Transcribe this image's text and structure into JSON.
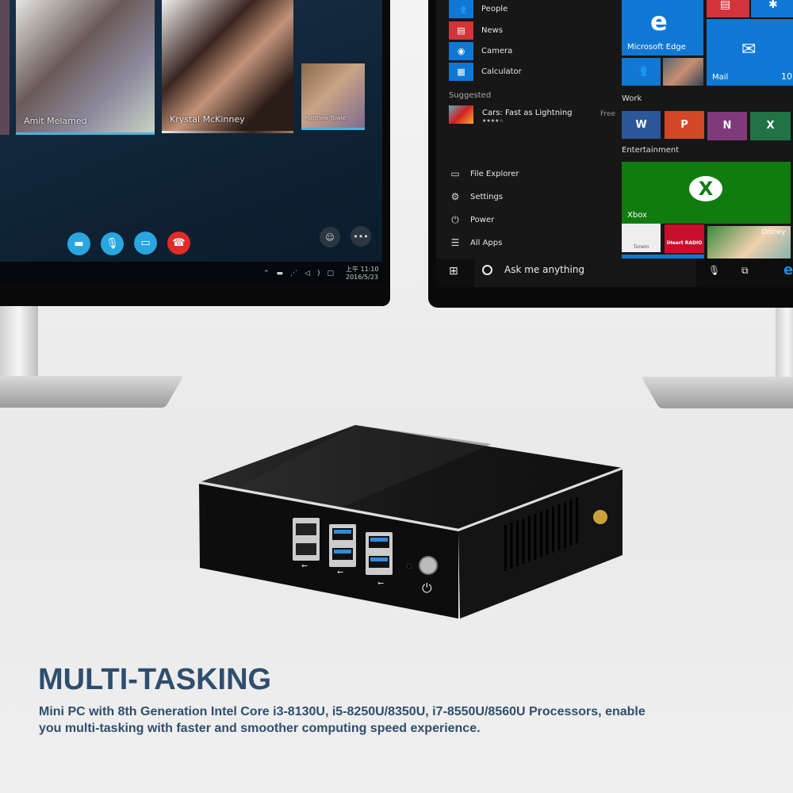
{
  "video_call": {
    "participants": [
      {
        "name": "Amit Melamed"
      },
      {
        "name": "Krystal McKinney"
      },
      {
        "name": "Matthew Towle"
      }
    ],
    "controls": [
      "video-icon",
      "microphone-icon",
      "screen-share-icon",
      "end-call-icon"
    ],
    "extra_controls": [
      "add-participant-icon",
      "more-icon"
    ],
    "more_label": "•••",
    "taskbar": {
      "time": "上午 11:10",
      "date": "2016/5/23"
    },
    "accent": "#29a6e0",
    "end_call_color": "#e12b2b"
  },
  "start_menu": {
    "apps": [
      {
        "label": "People",
        "icon": "people-icon",
        "color": "#0f78d4"
      },
      {
        "label": "News",
        "icon": "news-icon",
        "color": "#d1343a"
      },
      {
        "label": "Camera",
        "icon": "camera-icon",
        "color": "#0f78d4"
      },
      {
        "label": "Calculator",
        "icon": "calculator-icon",
        "color": "#0f78d4"
      }
    ],
    "suggested_heading": "Suggested",
    "suggested": {
      "title": "Cars: Fast as Lightning",
      "price": "Free",
      "rating": "★★★★☆"
    },
    "bottom": [
      {
        "label": "File Explorer",
        "icon": "folder-icon"
      },
      {
        "label": "Settings",
        "icon": "gear-icon"
      },
      {
        "label": "Power",
        "icon": "power-icon"
      },
      {
        "label": "All Apps",
        "icon": "list-icon"
      }
    ],
    "tiles": {
      "edge": "Microsoft Edge",
      "mail": "Mail",
      "mail_count": "10",
      "work_heading": "Work",
      "work_apps": [
        {
          "letter": "W",
          "color": "#2b579a"
        },
        {
          "letter": "P",
          "color": "#d24726"
        },
        {
          "letter": "N",
          "color": "#80397b"
        },
        {
          "letter": "X",
          "color": "#217346"
        }
      ],
      "entertainment_heading": "Entertainment",
      "xbox": "Xbox",
      "tunein": "TuneIn",
      "iheart": "iHeart RADIO",
      "disney": "Disney"
    },
    "search_placeholder": "Ask me anything",
    "tile_blue": "#0f78d4",
    "xbox_green": "#107c10"
  },
  "product": {
    "usb_symbol": "⭠",
    "body_color": "#111111",
    "usb3_color": "#2f8be0"
  },
  "headline": "MULTI-TASKING",
  "description": "Mini PC with 8th Generation Intel Core i3-8130U, i5-8250U/8350U, i7-8550U/8560U Processors, enable you multi-tasking with faster and smoother computing speed experience.",
  "text_color": "#2f4e6e"
}
